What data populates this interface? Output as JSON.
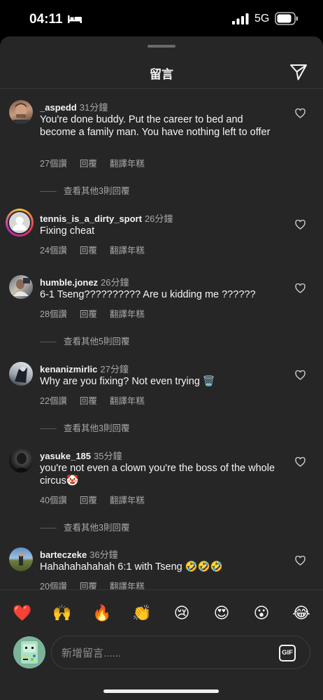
{
  "status_bar": {
    "time": "04:11",
    "network": "5G",
    "time_icon": "bed-icon",
    "signal_icon": "signal-bars-icon",
    "battery_icon": "battery-icon"
  },
  "sheet": {
    "title": "留言",
    "share_icon": "paper-plane-icon"
  },
  "comments": [
    {
      "username": "_aspedd",
      "time": "31分鐘",
      "text": "You're done buddy. Put the career to bed and become a family man. You have nothing left to offer",
      "likes": "27個讚",
      "reply": "回覆",
      "translate": "翻譯年糕",
      "view_replies": "查看其他3則回覆"
    },
    {
      "username": "tennis_is_a_dirty_sport",
      "time": "26分鐘",
      "text": "Fixing cheat",
      "likes": "24個讚",
      "reply": "回覆",
      "translate": "翻譯年糕",
      "view_replies": ""
    },
    {
      "username": "humble.jonez",
      "time": "26分鐘",
      "text": "6-1 Tseng?????????? Are u kidding me ??????",
      "likes": "28個讚",
      "reply": "回覆",
      "translate": "翻譯年糕",
      "view_replies": "查看其他5則回覆"
    },
    {
      "username": "kenanizmirlic",
      "time": "27分鐘",
      "text": "Why are you fixing? Not even trying 🗑️",
      "likes": "22個讚",
      "reply": "回覆",
      "translate": "翻譯年糕",
      "view_replies": "查看其他3則回覆"
    },
    {
      "username": "yasuke_185",
      "time": "35分鐘",
      "text": "you're not even a clown you're the boss of the whole circus🤡",
      "likes": "40個讚",
      "reply": "回覆",
      "translate": "翻譯年糕",
      "view_replies": "查看其他3則回覆"
    },
    {
      "username": "barteczeke",
      "time": "36分鐘",
      "text": "Hahahahahahah 6:1 with Tseng 🤣🤣🤣",
      "likes": "20個讚",
      "reply": "回覆",
      "translate": "翻譯年糕",
      "view_replies": ""
    }
  ],
  "emojis": [
    "❤️",
    "🙌",
    "🔥",
    "👏",
    "😢",
    "😍",
    "😮",
    "😂"
  ],
  "composer": {
    "placeholder": "新增留言......",
    "gif_label": "GIF"
  }
}
